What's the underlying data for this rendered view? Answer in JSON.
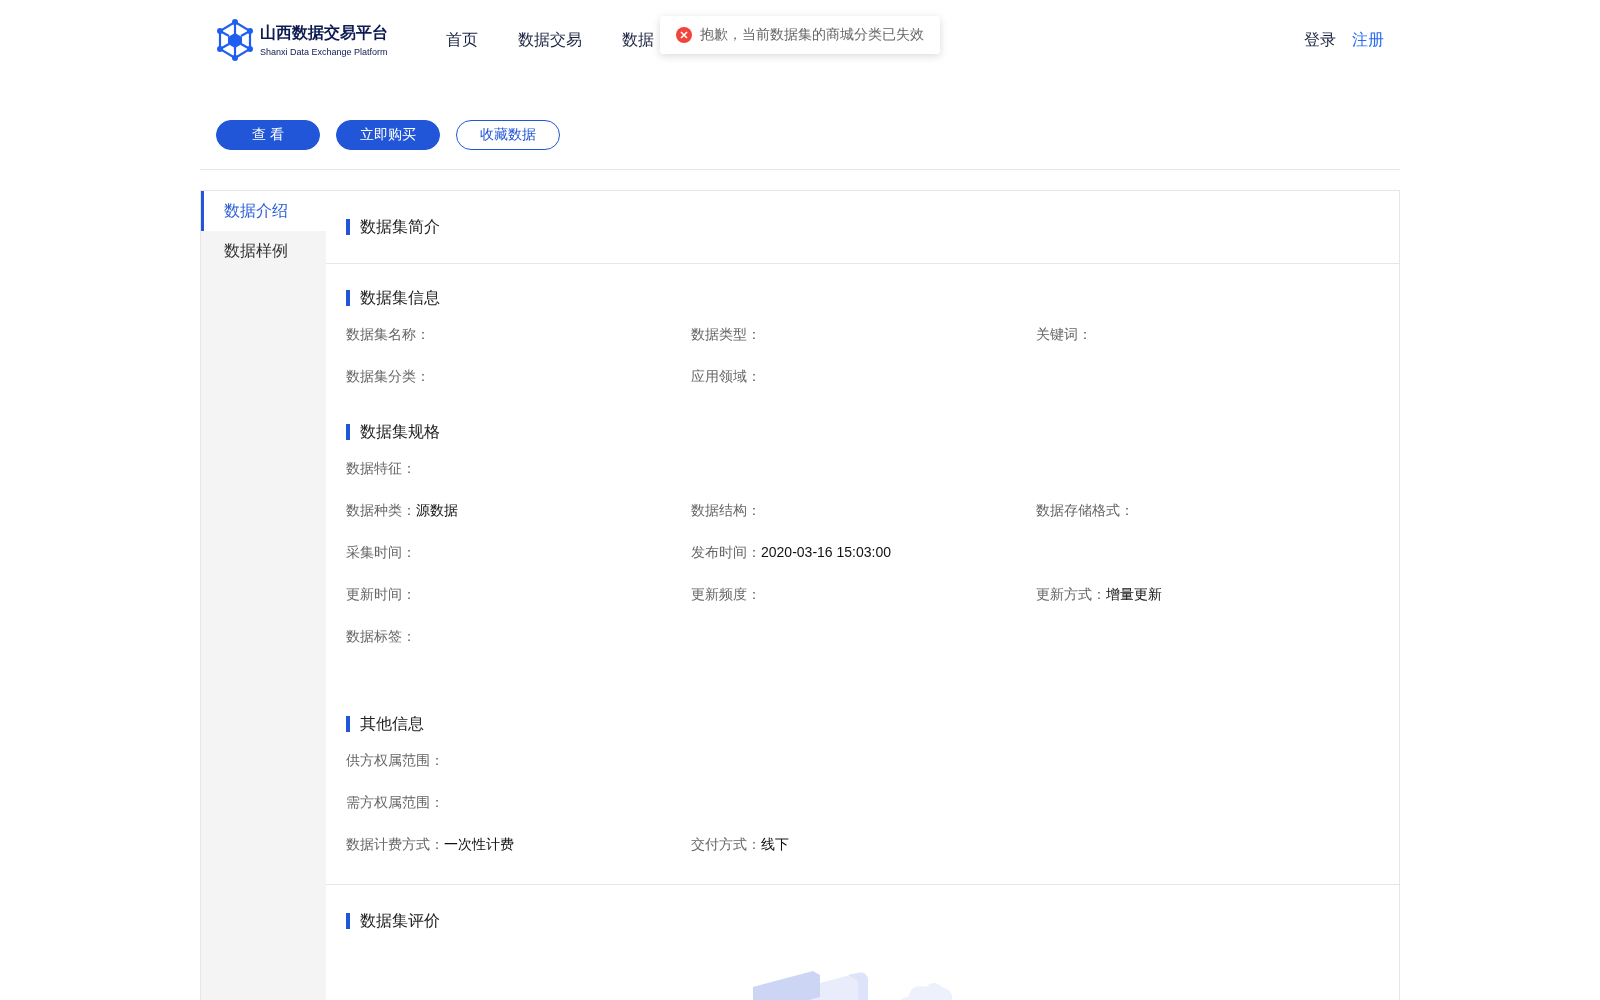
{
  "header": {
    "logo": {
      "title": "山西数据交易平台",
      "subtitle": "Shanxi Data Exchange Platform"
    },
    "nav": [
      {
        "label": "首页"
      },
      {
        "label": "数据交易"
      },
      {
        "label": "数据"
      }
    ],
    "auth": [
      {
        "label": "登录",
        "kind": "plain"
      },
      {
        "label": "注册",
        "kind": "accent"
      }
    ]
  },
  "toast": {
    "kind": "error",
    "message": "抱歉，当前数据集的商城分类已失效"
  },
  "actions": [
    {
      "label": "查 看",
      "kind": "primary"
    },
    {
      "label": "立即购买",
      "kind": "primary"
    },
    {
      "label": "收藏数据",
      "kind": "outline"
    }
  ],
  "sidebar": {
    "items": [
      {
        "label": "数据介绍",
        "selected": true
      },
      {
        "label": "数据样例",
        "selected": false
      }
    ]
  },
  "sections": [
    {
      "title": "数据集简介",
      "kind": "intro"
    },
    {
      "title": "数据集信息",
      "kind": "fields",
      "rows": [
        [
          {
            "label": "数据集名称："
          },
          {
            "label": "数据类型："
          },
          {
            "label": "关键词："
          }
        ],
        [
          {
            "label": "数据集分类："
          },
          {
            "label": "应用领域："
          }
        ]
      ]
    },
    {
      "title": "数据集规格",
      "kind": "fields",
      "rows": [
        [
          {
            "label": "数据特征："
          }
        ],
        [
          {
            "label": "数据种类：",
            "value": "源数据"
          },
          {
            "label": "数据结构："
          },
          {
            "label": "数据存储格式："
          }
        ],
        [
          {
            "label": "采集时间："
          },
          {
            "label": "发布时间：",
            "value": "2020-03-16 15:03:00"
          }
        ],
        [
          {
            "label": "更新时间："
          },
          {
            "label": "更新频度："
          },
          {
            "label": "更新方式：",
            "value": "增量更新"
          }
        ],
        [
          {
            "label": "数据标签："
          }
        ]
      ]
    },
    {
      "title": "其他信息",
      "kind": "fields",
      "rows": [
        [
          {
            "label": "供方权属范围："
          }
        ],
        [
          {
            "label": "需方权属范围："
          }
        ],
        [
          {
            "label": "数据计费方式：",
            "value": "一次性计费"
          },
          {
            "label": "交付方式：",
            "value": "线下"
          }
        ]
      ]
    },
    {
      "title": "数据集评价",
      "kind": "empty"
    }
  ]
}
